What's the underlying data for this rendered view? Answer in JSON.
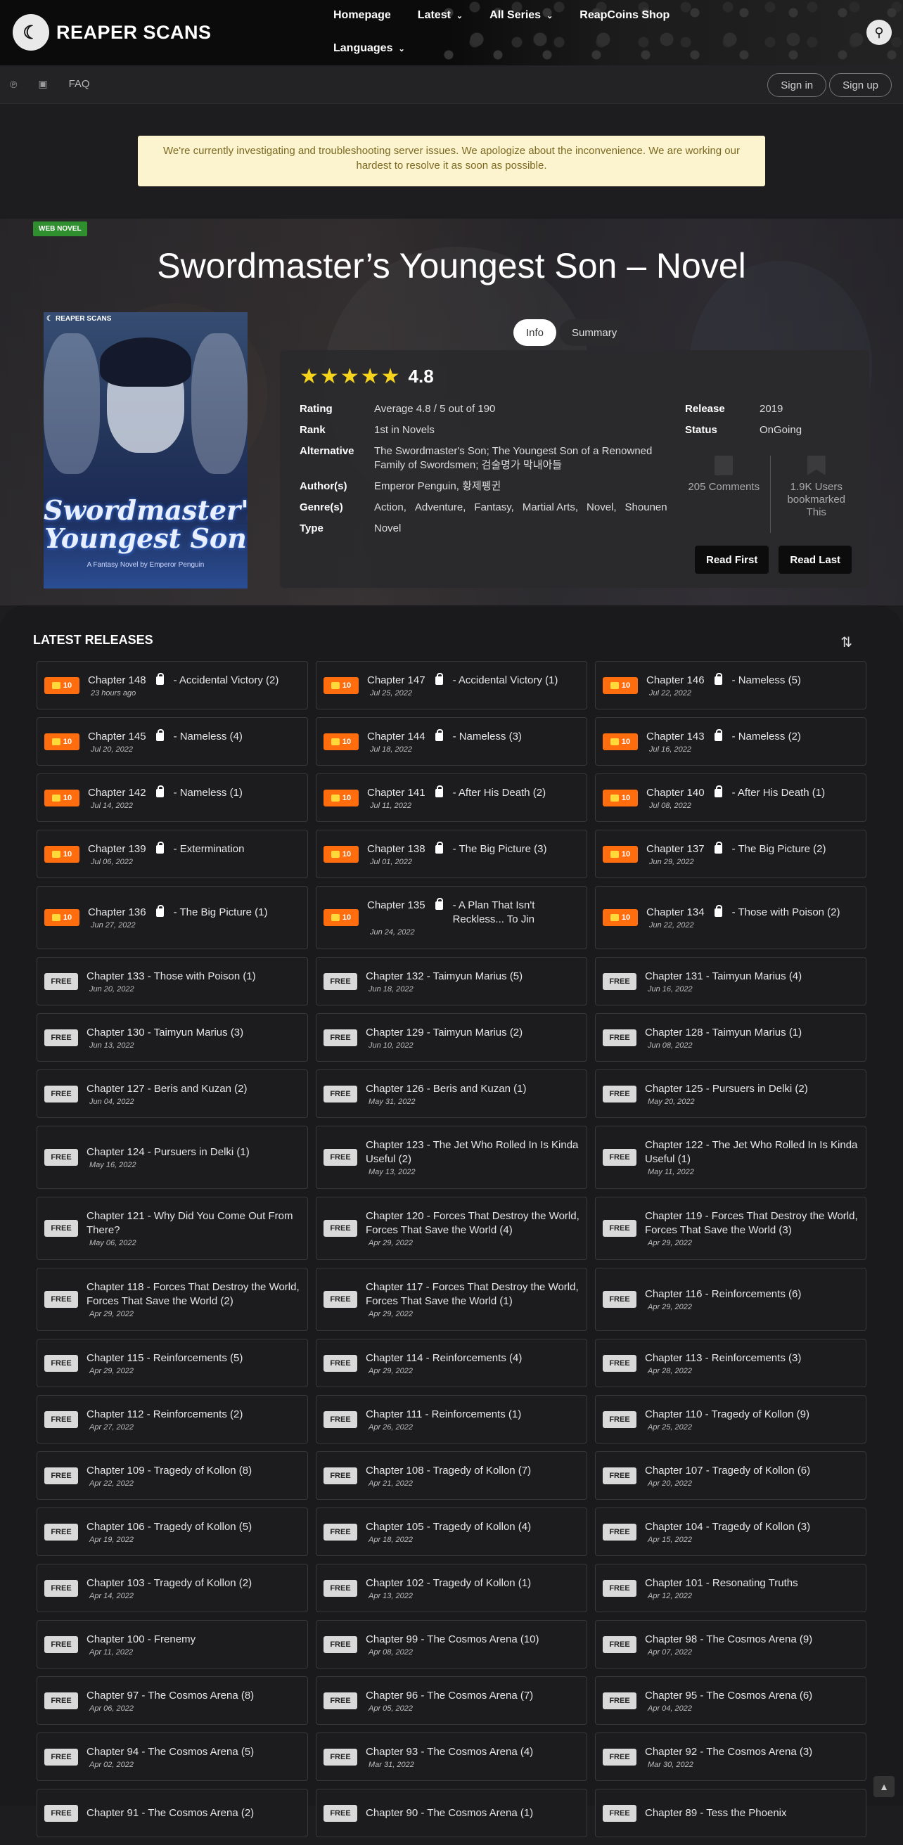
{
  "site": {
    "logo_text": "REAPER SCANS"
  },
  "nav": {
    "items": [
      "Homepage",
      "Latest",
      "All Series",
      "ReapCoins Shop"
    ],
    "languages": "Languages"
  },
  "subbar": {
    "faq": "FAQ",
    "signin": "Sign in",
    "signup": "Sign up"
  },
  "notice": "We're currently investigating and troubleshooting server issues. We apologize about the inconvenience. We are working our hardest to resolve it as soon as possible.",
  "series": {
    "badge": "WEB NOVEL",
    "title": "Swordmaster’s Youngest Son – Novel",
    "cover_title": "Swordmaster's Youngest Son",
    "cover_author": "A Fantasy Novel by Emperor Penguin",
    "cover_tag": "REAPER SCANS",
    "tabs": [
      "Info",
      "Summary"
    ],
    "rating_value": "4.8",
    "rows": [
      {
        "label": "Rating",
        "value": "Average 4.8 / 5 out of 190"
      },
      {
        "label": "Rank",
        "value": "1st in Novels"
      },
      {
        "label": "Alternative",
        "value": "The Swordmaster's Son; The Youngest Son of a Renowned Family of Swordsmen; 검술명가 막내아들"
      },
      {
        "label": "Author(s)",
        "value": "Emperor Penguin,  황제펭귄"
      },
      {
        "label": "Genre(s)",
        "genres": [
          "Action,",
          "Adventure,",
          "Fantasy,",
          "Martial Arts,",
          "Novel,",
          "Shounen"
        ]
      },
      {
        "label": "Type",
        "value": "Novel"
      }
    ],
    "release_label": "Release",
    "release_value": "2019",
    "status_label": "Status",
    "status_value": "OnGoing",
    "comments": "205 Comments",
    "bookmarks": "1.9K Users bookmarked This",
    "read_first": "Read First",
    "read_last": "Read Last"
  },
  "releases": {
    "heading": "LATEST RELEASES",
    "coin_label": "10",
    "free_label": "FREE",
    "chapters": [
      {
        "n": "Chapter 148",
        "t": "- Accidental Victory (2)",
        "d": "23 hours ago",
        "locked": true
      },
      {
        "n": "Chapter 147",
        "t": "- Accidental Victory (1)",
        "d": "Jul 25, 2022",
        "locked": true
      },
      {
        "n": "Chapter 146",
        "t": "- Nameless (5)",
        "d": "Jul 22, 2022",
        "locked": true
      },
      {
        "n": "Chapter 145",
        "t": "- Nameless (4)",
        "d": "Jul 20, 2022",
        "locked": true
      },
      {
        "n": "Chapter 144",
        "t": "- Nameless (3)",
        "d": "Jul 18, 2022",
        "locked": true
      },
      {
        "n": "Chapter 143",
        "t": "- Nameless (2)",
        "d": "Jul 16, 2022",
        "locked": true
      },
      {
        "n": "Chapter 142",
        "t": "- Nameless (1)",
        "d": "Jul 14, 2022",
        "locked": true
      },
      {
        "n": "Chapter 141",
        "t": "- After His Death (2)",
        "d": "Jul 11, 2022",
        "locked": true
      },
      {
        "n": "Chapter 140",
        "t": "- After His Death (1)",
        "d": "Jul 08, 2022",
        "locked": true
      },
      {
        "n": "Chapter 139",
        "t": "- Extermination",
        "d": "Jul 06, 2022",
        "locked": true
      },
      {
        "n": "Chapter 138",
        "t": "- The Big Picture (3)",
        "d": "Jul 01, 2022",
        "locked": true
      },
      {
        "n": "Chapter 137",
        "t": "- The Big Picture (2)",
        "d": "Jun 29, 2022",
        "locked": true
      },
      {
        "n": "Chapter 136",
        "t": "- The Big Picture (1)",
        "d": "Jun 27, 2022",
        "locked": true
      },
      {
        "n": "Chapter 135",
        "t": "- A Plan That Isn't Reckless... To Jin",
        "d": "Jun 24, 2022",
        "locked": true
      },
      {
        "n": "Chapter 134",
        "t": "- Those with Poison (2)",
        "d": "Jun 22, 2022",
        "locked": true
      },
      {
        "n": "Chapter 133 - Those with Poison (1)",
        "d": "Jun 20, 2022",
        "locked": false
      },
      {
        "n": "Chapter 132 - Taimyun Marius (5)",
        "d": "Jun 18, 2022",
        "locked": false
      },
      {
        "n": "Chapter 131 - Taimyun Marius (4)",
        "d": "Jun 16, 2022",
        "locked": false
      },
      {
        "n": "Chapter 130 - Taimyun Marius (3)",
        "d": "Jun 13, 2022",
        "locked": false
      },
      {
        "n": "Chapter 129 - Taimyun Marius (2)",
        "d": "Jun 10, 2022",
        "locked": false
      },
      {
        "n": "Chapter 128 - Taimyun Marius (1)",
        "d": "Jun 08, 2022",
        "locked": false
      },
      {
        "n": "Chapter 127 - Beris and Kuzan (2)",
        "d": "Jun 04, 2022",
        "locked": false
      },
      {
        "n": "Chapter 126 - Beris and Kuzan (1)",
        "d": "May 31, 2022",
        "locked": false
      },
      {
        "n": "Chapter 125 - Pursuers in Delki (2)",
        "d": "May 20, 2022",
        "locked": false
      },
      {
        "n": "Chapter 124 - Pursuers in Delki (1)",
        "d": "May 16, 2022",
        "locked": false
      },
      {
        "n": "Chapter 123 - The Jet Who Rolled In Is Kinda Useful (2)",
        "d": "May 13, 2022",
        "locked": false
      },
      {
        "n": "Chapter 122 - The Jet Who Rolled In Is Kinda Useful (1)",
        "d": "May 11, 2022",
        "locked": false
      },
      {
        "n": "Chapter 121 - Why Did You Come Out From There?",
        "d": "May 06, 2022",
        "locked": false
      },
      {
        "n": "Chapter 120 - Forces That Destroy the World, Forces That Save the World (4)",
        "d": "Apr 29, 2022",
        "locked": false
      },
      {
        "n": "Chapter 119 - Forces That Destroy the World, Forces That Save the World (3)",
        "d": "Apr 29, 2022",
        "locked": false
      },
      {
        "n": "Chapter 118 - Forces That Destroy the World, Forces That Save the World (2)",
        "d": "Apr 29, 2022",
        "locked": false
      },
      {
        "n": "Chapter 117 - Forces That Destroy the World, Forces That Save the World (1)",
        "d": "Apr 29, 2022",
        "locked": false
      },
      {
        "n": "Chapter 116 - Reinforcements (6)",
        "d": "Apr 29, 2022",
        "locked": false
      },
      {
        "n": "Chapter 115 - Reinforcements (5)",
        "d": "Apr 29, 2022",
        "locked": false
      },
      {
        "n": "Chapter 114 - Reinforcements (4)",
        "d": "Apr 29, 2022",
        "locked": false
      },
      {
        "n": "Chapter 113 - Reinforcements (3)",
        "d": "Apr 28, 2022",
        "locked": false
      },
      {
        "n": "Chapter 112 - Reinforcements (2)",
        "d": "Apr 27, 2022",
        "locked": false
      },
      {
        "n": "Chapter 111 - Reinforcements (1)",
        "d": "Apr 26, 2022",
        "locked": false
      },
      {
        "n": "Chapter 110 - Tragedy of Kollon (9)",
        "d": "Apr 25, 2022",
        "locked": false
      },
      {
        "n": "Chapter 109 - Tragedy of Kollon (8)",
        "d": "Apr 22, 2022",
        "locked": false
      },
      {
        "n": "Chapter 108 - Tragedy of Kollon (7)",
        "d": "Apr 21, 2022",
        "locked": false
      },
      {
        "n": "Chapter 107 - Tragedy of Kollon (6)",
        "d": "Apr 20, 2022",
        "locked": false
      },
      {
        "n": "Chapter 106 - Tragedy of Kollon (5)",
        "d": "Apr 19, 2022",
        "locked": false
      },
      {
        "n": "Chapter 105 - Tragedy of Kollon (4)",
        "d": "Apr 18, 2022",
        "locked": false
      },
      {
        "n": "Chapter 104 - Tragedy of Kollon (3)",
        "d": "Apr 15, 2022",
        "locked": false
      },
      {
        "n": "Chapter 103 - Tragedy of Kollon (2)",
        "d": "Apr 14, 2022",
        "locked": false
      },
      {
        "n": "Chapter 102 - Tragedy of Kollon (1)",
        "d": "Apr 13, 2022",
        "locked": false
      },
      {
        "n": "Chapter 101 - Resonating Truths",
        "d": "Apr 12, 2022",
        "locked": false
      },
      {
        "n": "Chapter 100 - Frenemy",
        "d": "Apr 11, 2022",
        "locked": false
      },
      {
        "n": "Chapter 99 - The Cosmos Arena (10)",
        "d": "Apr 08, 2022",
        "locked": false
      },
      {
        "n": "Chapter 98 - The Cosmos Arena (9)",
        "d": "Apr 07, 2022",
        "locked": false
      },
      {
        "n": "Chapter 97 - The Cosmos Arena (8)",
        "d": "Apr 06, 2022",
        "locked": false
      },
      {
        "n": "Chapter 96 - The Cosmos Arena (7)",
        "d": "Apr 05, 2022",
        "locked": false
      },
      {
        "n": "Chapter 95 - The Cosmos Arena (6)",
        "d": "Apr 04, 2022",
        "locked": false
      },
      {
        "n": "Chapter 94 - The Cosmos Arena (5)",
        "d": "Apr 02, 2022",
        "locked": false
      },
      {
        "n": "Chapter 93 - The Cosmos Arena (4)",
        "d": "Mar 31, 2022",
        "locked": false
      },
      {
        "n": "Chapter 92 - The Cosmos Arena (3)",
        "d": "Mar 30, 2022",
        "locked": false
      },
      {
        "n": "Chapter 91 - The Cosmos Arena (2)",
        "d": "",
        "locked": false
      },
      {
        "n": "Chapter 90 - The Cosmos Arena (1)",
        "d": "",
        "locked": false
      },
      {
        "n": "Chapter 89 - Tess the Phoenix",
        "d": "",
        "locked": false
      }
    ]
  },
  "colors": {
    "coin": "#ff6d0f",
    "free": "#d9d9d9",
    "notice_bg": "#fbf4cf",
    "star": "#f6d31c"
  },
  "icons": [
    "search-icon",
    "coin-icon",
    "lock-icon",
    "sort-icon",
    "comment-icon",
    "bookmark-icon",
    "arrow-up-icon",
    "chevron-down-icon"
  ]
}
